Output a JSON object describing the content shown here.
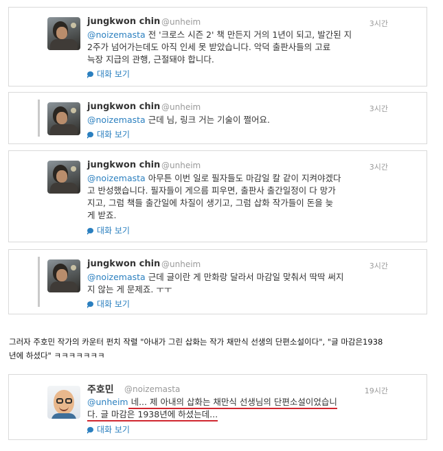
{
  "tweets": [
    {
      "name": "jungkwon chin",
      "handle": "@unheim",
      "time": "3시간",
      "mention": "@noizemasta",
      "line1": " 전 '크로스 시즌 2' 책 만든지 거의 1년이 되고, 발간된 지",
      "line2": "2주가 넘어가는데도 아직 인세 못 받았습니다. 악덕 출판사들의 고료",
      "line3": "늑장 지급의 관행, 근절돼야 합니다.",
      "convo": "대화 보기"
    },
    {
      "name": "jungkwon chin",
      "handle": "@unheim",
      "time": "3시간",
      "mention": "@noizemasta",
      "line1": " 근데 님, 링크 거는 기술이 쩔어요.",
      "convo": "대화 보기"
    },
    {
      "name": "jungkwon chin",
      "handle": "@unheim",
      "time": "3시간",
      "mention": "@noizemasta",
      "line1": " 아무튼 이번 일로 필자들도 마감일 칼 같이 지켜야겠다",
      "line2": "고 반성했습니다. 필자들이 게으름 피우면, 출판사 출간일정이 다 망가",
      "line3": "지고, 그럼 책들 출간일에 차질이 생기고, 그럼 삽화 작가들이 돈을 늦",
      "line4": "게 받죠.",
      "convo": "대화 보기"
    },
    {
      "name": "jungkwon chin",
      "handle": "@unheim",
      "time": "3시간",
      "mention": "@noizemasta",
      "line1": " 근데 글이란 게 만화랑 달라서 마감일 맞춰서 딱딱 써지",
      "line2": "지 않는 게 문제죠. ㅜㅜ",
      "convo": "대화 보기"
    }
  ],
  "caption": {
    "line1": "그러자 주호민 작가의 카운터 펀치 작렬 \"아내가 그린 삽화는 작가 채만식 선생의 단편소설이다\", \"글 마감은1938",
    "line2": "년에 하셨다\" ㅋㅋㅋㅋㅋㅋㅋ"
  },
  "reply": {
    "name": "주호민",
    "handle": "@noizemasta",
    "time": "19시간",
    "mention": "@unheim",
    "line1": " 네... 제 아내의 삽화는 채만식 선생님의 단편소설이었습니",
    "line2": "다. 글 마감은 1938년에 하셨는데...",
    "convo": "대화 보기"
  },
  "colors": {
    "link": "#2a7fbf",
    "underline": "#d0262e"
  }
}
